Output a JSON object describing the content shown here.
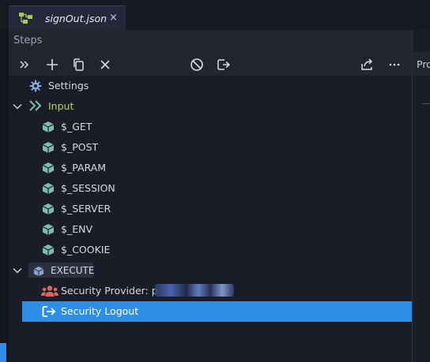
{
  "tab": {
    "title": "signOut.json",
    "close": "×"
  },
  "steps_panel": {
    "title": "Steps"
  },
  "right_panel": {
    "title": "Pro"
  },
  "tree": {
    "settings": "Settings",
    "input": "Input",
    "input_children": [
      "$_GET",
      "$_POST",
      "$_PARAM",
      "$_SESSION",
      "$_SERVER",
      "$_ENV",
      "$_COOKIE"
    ],
    "execute": "EXECUTE",
    "security_provider": "Security Provider: p",
    "security_logout": "Security Logout"
  },
  "colors": {
    "selection": "#2d8ee8",
    "input_label": "#b6cf6a",
    "cube": "#7fbab5",
    "users_icon": "#e0665a"
  }
}
